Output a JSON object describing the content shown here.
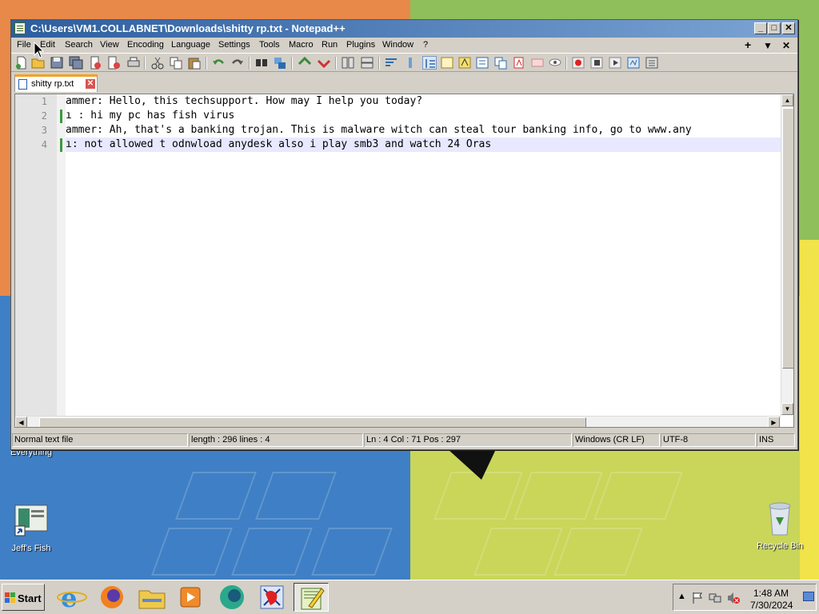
{
  "window": {
    "title": "C:\\Users\\VM1.COLLABNET\\Downloads\\shitty rp.txt - Notepad++",
    "minimize": "_",
    "maximize": "□",
    "close": "✕"
  },
  "menu": {
    "items": [
      "File",
      "Edit",
      "Search",
      "View",
      "Encoding",
      "Language",
      "Settings",
      "Tools",
      "Macro",
      "Run",
      "Plugins",
      "Window",
      "?"
    ],
    "plus": "+",
    "dropdown": "▼",
    "close": "✕"
  },
  "toolbar": {
    "icons": [
      "new-file-icon",
      "open-file-icon",
      "save-icon",
      "save-all-icon",
      "close-icon",
      "close-all-icon",
      "print-icon",
      "cut-icon",
      "copy-icon",
      "paste-icon",
      "undo-icon",
      "redo-icon",
      "find-icon",
      "replace-icon",
      "zoom-in-icon",
      "zoom-out-icon",
      "sync-v-icon",
      "sync-h-icon",
      "word-wrap-icon",
      "show-all-chars-icon",
      "indent-guide-icon",
      "udl-icon",
      "doc-map-icon",
      "function-list-icon",
      "folder-workspace-icon",
      "monitoring-icon",
      "record-macro-icon",
      "stop-macro-icon",
      "play-macro-icon",
      "run-macro-icon",
      "save-macro-icon"
    ]
  },
  "tab": {
    "label": "shitty rp.txt",
    "close": "✕"
  },
  "editor": {
    "line_numbers": [
      "1",
      "2",
      "3",
      "4"
    ],
    "lines": [
      "ammer: Hello, this techsupport. How may I help you today?",
      "ı : hi my pc has fish virus",
      "ammer: Ah, that's a banking trojan. This is malware witch can steal tour banking info, go to www.any",
      "ı: not allowed t odnwload anydesk also i play smb3 and watch 24 Oras"
    ],
    "current_line": 4
  },
  "statusbar": {
    "file_type": "Normal text file",
    "length": "length : 296    lines : 4",
    "position": "Ln : 4    Col : 71    Pos : 297",
    "eol": "Windows (CR LF)",
    "encoding": "UTF-8",
    "mode": "INS"
  },
  "desktop": {
    "icons": [
      {
        "label": "Everything"
      },
      {
        "label": "Jeff's Fish"
      },
      {
        "label": "Recycle Bin"
      }
    ]
  },
  "taskbar": {
    "start_label": "Start",
    "apps": [
      "internet-explorer-icon",
      "firefox-icon",
      "file-explorer-icon",
      "media-player-icon",
      "app-globe-icon",
      "app-red-icon",
      "notepadpp-icon"
    ],
    "clock_time": "1:48 AM",
    "clock_date": "7/30/2024"
  },
  "colors": {
    "titlebar": "#2c5e9e",
    "tab_accent": "#f6a21d",
    "current_line": "#e8e8ff",
    "change_bar": "#3c9a3c"
  }
}
